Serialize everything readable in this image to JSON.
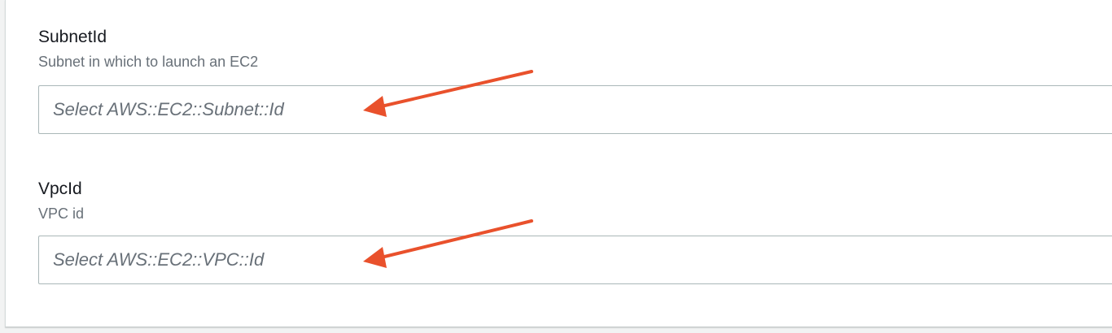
{
  "parameters": [
    {
      "label": "SubnetId",
      "description": "Subnet in which to launch an EC2",
      "placeholder": "Select AWS::EC2::Subnet::Id"
    },
    {
      "label": "VpcId",
      "description": "VPC id",
      "placeholder": "Select AWS::EC2::VPC::Id"
    }
  ],
  "colors": {
    "annotation_arrow": "#e9512c",
    "label_text": "#16191f",
    "description_text": "#687078",
    "input_border": "#aab7b8"
  },
  "icons": {
    "annotation": "arrow-left-icon"
  }
}
